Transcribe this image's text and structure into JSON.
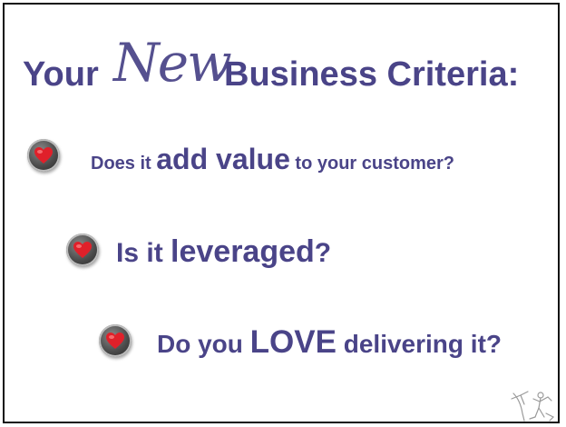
{
  "title": {
    "part1": "Your",
    "script": "New",
    "part2": "Business Criteria:"
  },
  "bullets": [
    {
      "pre": "Does it ",
      "emph": "add value",
      "post": " to your customer?"
    },
    {
      "pre": "Is it ",
      "emph": "leveraged",
      "post": "?"
    },
    {
      "pre": "Do you ",
      "emph": "LOVE",
      "post": " delivering it?"
    }
  ],
  "icons": {
    "bullet": "heart-icon",
    "corner": "logo-mark"
  },
  "colors": {
    "text": "#4a4488",
    "heart": "#e0202a",
    "border": "#111111"
  }
}
